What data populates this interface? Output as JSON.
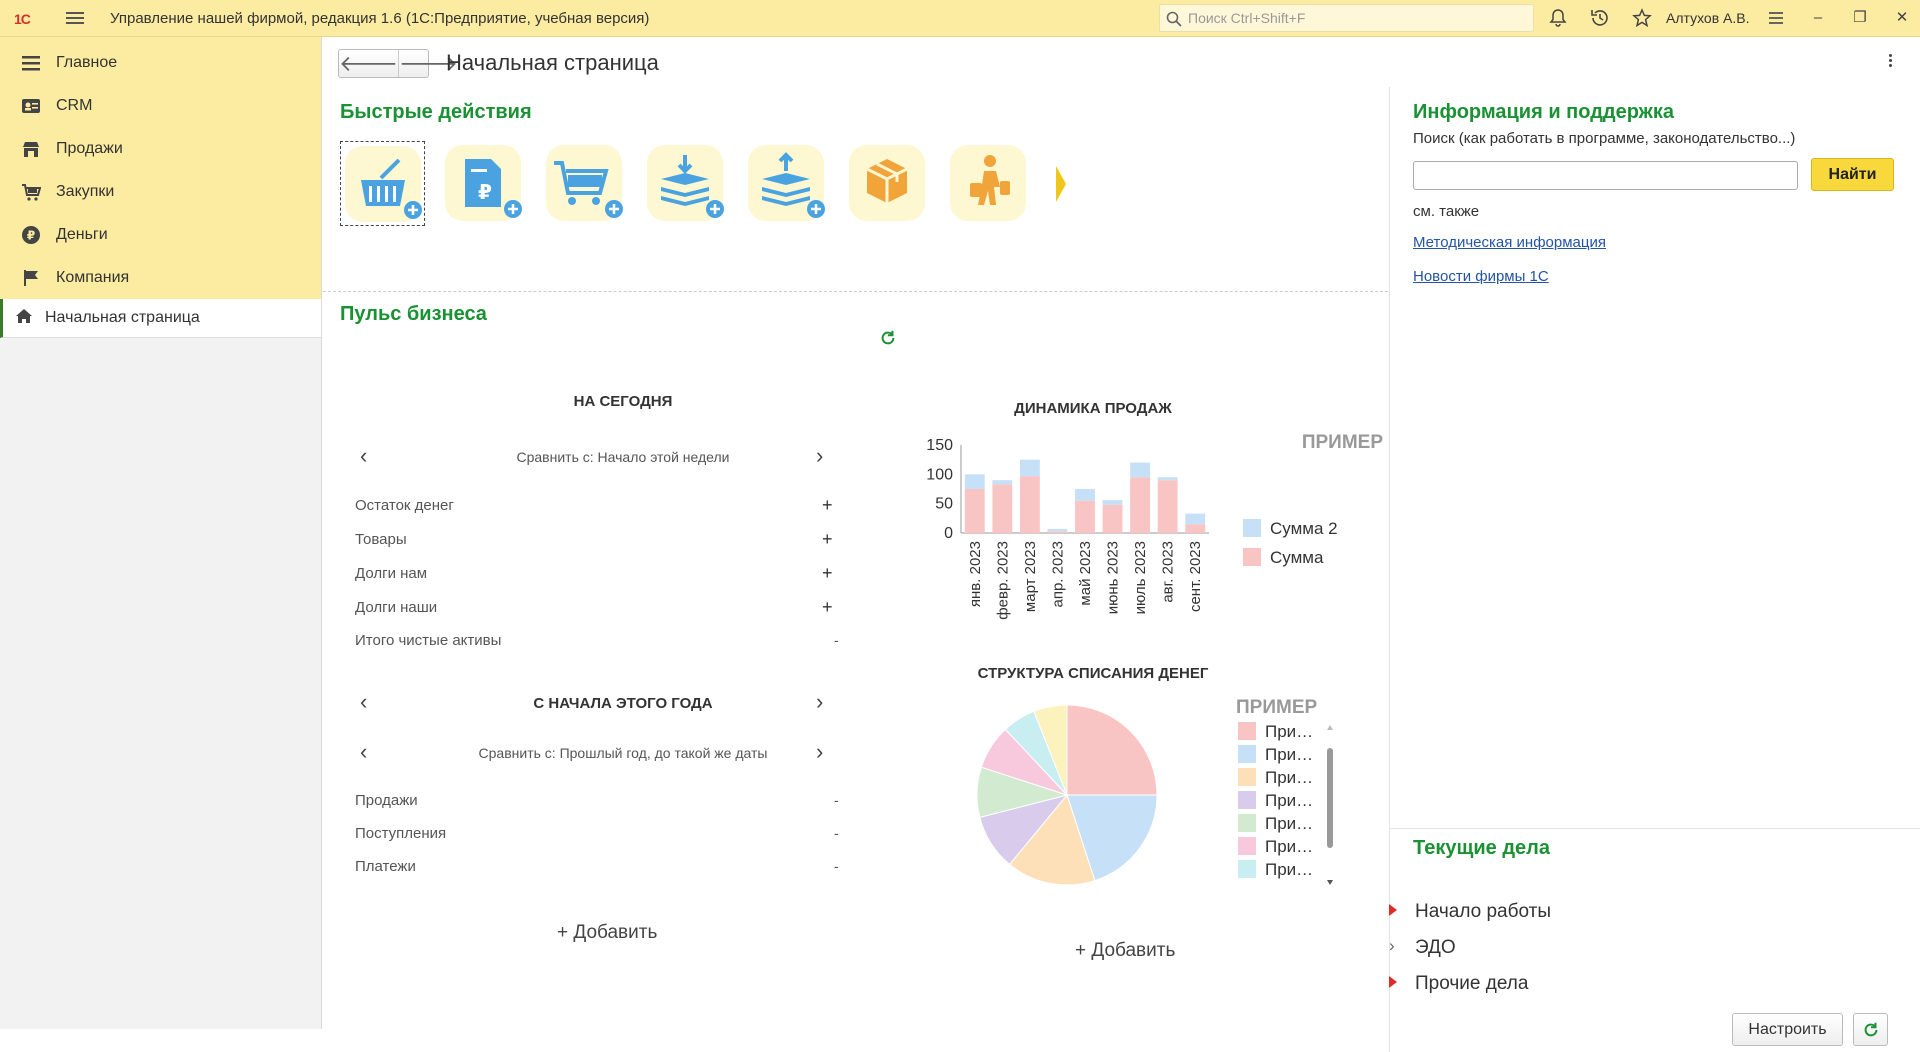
{
  "topbar": {
    "logo": "1С",
    "title": "Управление нашей фирмой, редакция 1.6  (1С:Предприятие, учебная версия)",
    "search_placeholder": "Поиск Ctrl+Shift+F",
    "user": "Алтухов А.В."
  },
  "sidebar": {
    "items": [
      {
        "label": "Главное",
        "icon": "menu-lines-icon"
      },
      {
        "label": "CRM",
        "icon": "contacts-icon"
      },
      {
        "label": "Продажи",
        "icon": "shop-icon"
      },
      {
        "label": "Закупки",
        "icon": "cart-icon"
      },
      {
        "label": "Деньги",
        "icon": "ruble-icon"
      },
      {
        "label": "Компания",
        "icon": "flag-icon"
      }
    ],
    "active": {
      "label": "Начальная страница",
      "icon": "home-icon"
    }
  },
  "page": {
    "title": "Начальная страница"
  },
  "quick_actions": {
    "title": "Быстрые действия",
    "items": [
      "new-sale-icon",
      "new-invoice-icon",
      "new-purchase-icon",
      "cash-receipt-icon",
      "cash-payment-icon",
      "goods-box-icon",
      "traveler-icon"
    ]
  },
  "pulse": {
    "title": "Пульс бизнеса",
    "today": {
      "title": "НА СЕГОДНЯ",
      "compare": "Сравнить с: Начало этой недели",
      "rows": [
        {
          "label": "Остаток денег",
          "value": "+"
        },
        {
          "label": "Товары",
          "value": "+"
        },
        {
          "label": "Долги нам",
          "value": "+"
        },
        {
          "label": "Долги наши",
          "value": "+"
        },
        {
          "label": "Итого чистые активы",
          "value": "-"
        }
      ]
    },
    "ytd": {
      "title": "С НАЧАЛА ЭТОГО ГОДА",
      "compare": "Сравнить с: Прошлый год, до такой же даты",
      "rows": [
        {
          "label": "Продажи",
          "value": "-"
        },
        {
          "label": "Поступления",
          "value": "-"
        },
        {
          "label": "Платежи",
          "value": "-"
        }
      ]
    },
    "add_left": "+ Добавить",
    "add_right": "+ Добавить"
  },
  "chart_data": [
    {
      "type": "bar",
      "title": "ДИНАМИКА ПРОДАЖ",
      "watermark": "ПРИМЕР",
      "stacked": true,
      "categories": [
        "янв. 2023",
        "февр. 2023",
        "март 2023",
        "апр. 2023",
        "май 2023",
        "июнь 2023",
        "июль 2023",
        "авг. 2023",
        "сент. 2023"
      ],
      "series": [
        {
          "name": "Сумма",
          "color": "#f9c4c4",
          "values": [
            75,
            83,
            97,
            3,
            55,
            48,
            95,
            90,
            15
          ]
        },
        {
          "name": "Сумма 2",
          "color": "#c6e0f7",
          "values": [
            25,
            7,
            28,
            4,
            20,
            8,
            25,
            5,
            18
          ]
        }
      ],
      "ylim": [
        0,
        150
      ],
      "yticks": [
        0,
        50,
        100,
        150
      ],
      "legend": "right"
    },
    {
      "type": "pie",
      "title": "СТРУКТУРА СПИСАНИЯ ДЕНЕГ",
      "watermark": "ПРИМЕР",
      "slices": [
        {
          "label": "При…",
          "value": 25,
          "color": "#f9c4c4"
        },
        {
          "label": "При…",
          "value": 20,
          "color": "#c6e0f7"
        },
        {
          "label": "При…",
          "value": 16,
          "color": "#fde0b8"
        },
        {
          "label": "При…",
          "value": 10,
          "color": "#d8cbec"
        },
        {
          "label": "При…",
          "value": 9,
          "color": "#d2ebd0"
        },
        {
          "label": "При…",
          "value": 8,
          "color": "#f8c8dc"
        },
        {
          "label": "При…",
          "value": 6,
          "color": "#c9eef2"
        },
        {
          "label": "",
          "value": 6,
          "color": "#fbf2bd"
        }
      ],
      "legend": "right"
    }
  ],
  "info": {
    "title": "Информация и поддержка",
    "search_label": "Поиск (как работать в программе, законодательство...)",
    "find_button": "Найти",
    "see_also": "см. также",
    "links": [
      "Методическая информация",
      "Новости фирмы 1С"
    ]
  },
  "tasks": {
    "title": "Текущие дела",
    "items": [
      {
        "label": "Начало работы",
        "marker": "red-triangle"
      },
      {
        "label": "ЭДО",
        "marker": "chevron"
      },
      {
        "label": "Прочие дела",
        "marker": "red-triangle"
      }
    ],
    "configure_button": "Настроить"
  },
  "colors": {
    "accent_green": "#1a9133",
    "topbar": "#fbeca2",
    "link": "#2454a6",
    "find_button": "#f8d83a"
  }
}
